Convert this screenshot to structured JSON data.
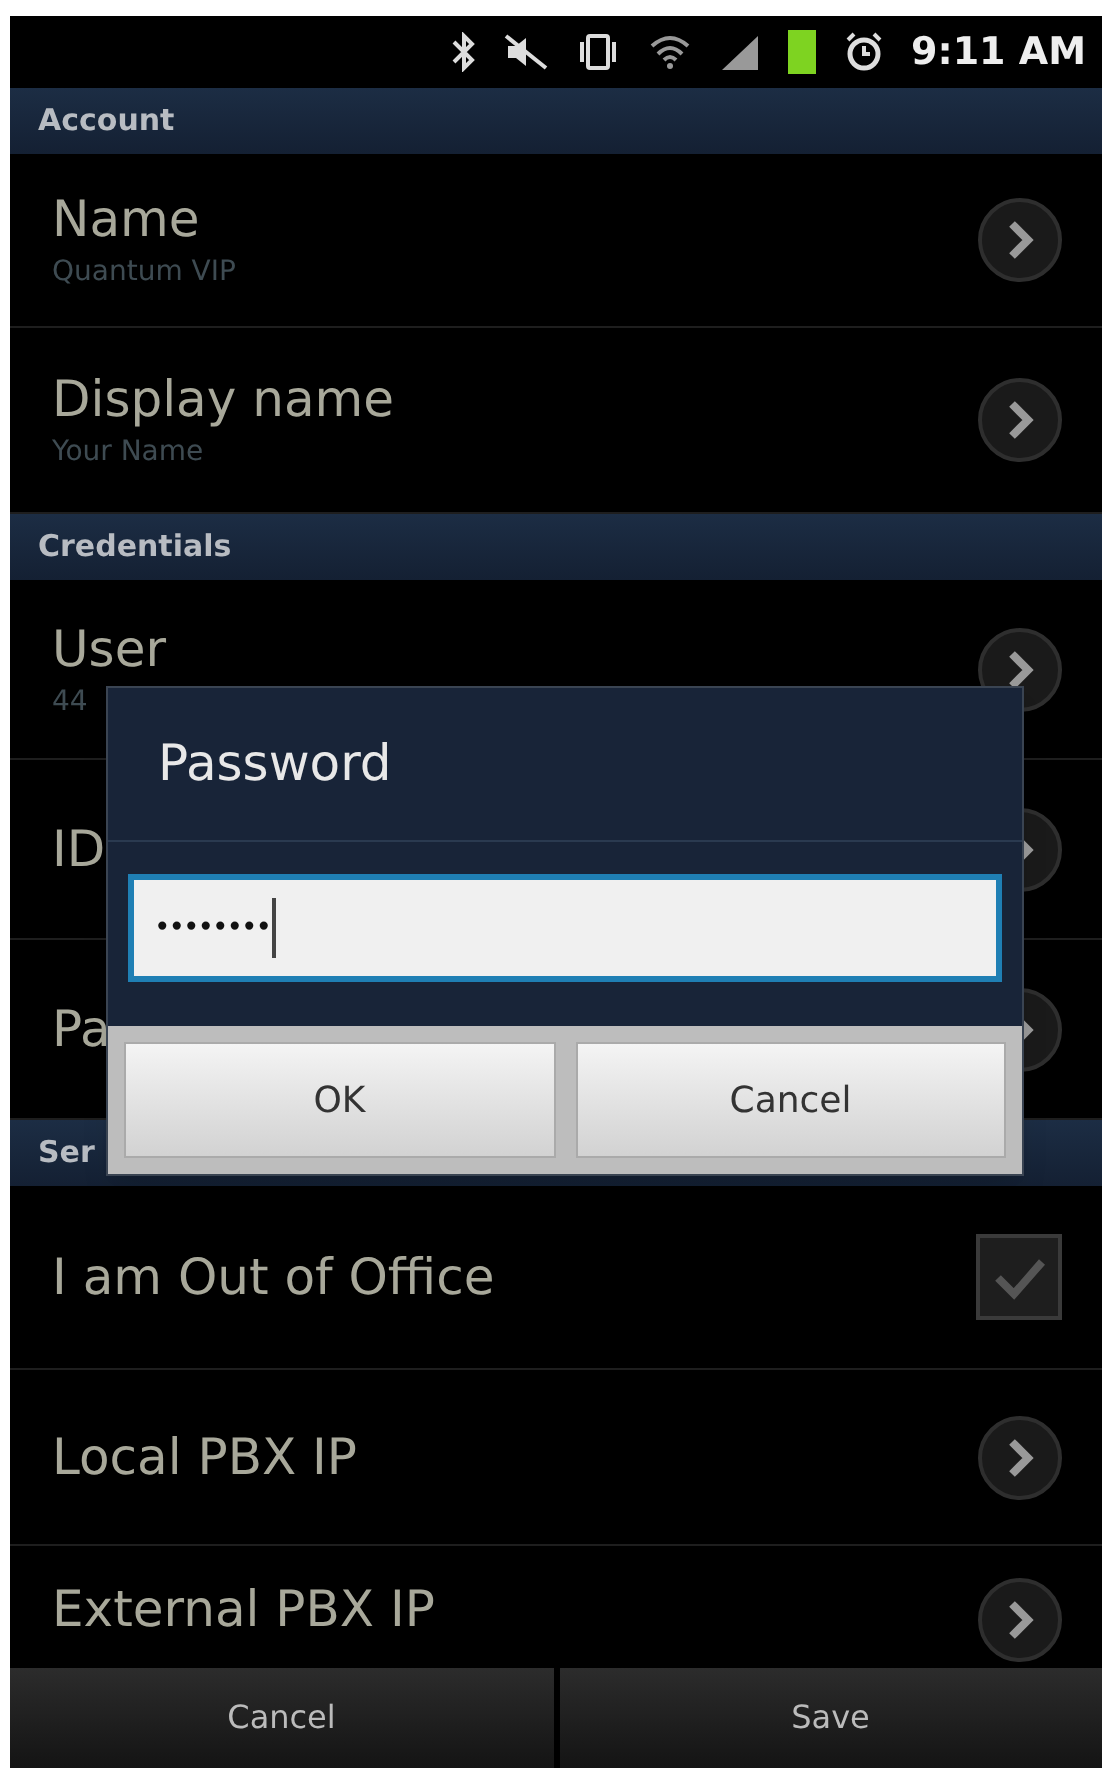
{
  "status_bar": {
    "time": "9:11 AM"
  },
  "sections": [
    {
      "title": "Account",
      "items": [
        {
          "kind": "chevron",
          "title": "Name",
          "summary": "Quantum VIP"
        },
        {
          "kind": "chevron",
          "title": "Display name",
          "summary": "Your Name"
        }
      ]
    },
    {
      "title": "Credentials",
      "items": [
        {
          "kind": "chevron",
          "title": "User",
          "summary": "44"
        },
        {
          "kind": "chevron",
          "title": "ID"
        },
        {
          "kind": "chevron",
          "title": "Pa"
        }
      ]
    },
    {
      "title": "Ser",
      "items": [
        {
          "kind": "checkbox",
          "title": "I am Out of Office",
          "checked": true
        },
        {
          "kind": "chevron",
          "title": "Local PBX IP"
        },
        {
          "kind": "chevron",
          "title": "External PBX IP"
        }
      ]
    }
  ],
  "dialog": {
    "title": "Password",
    "value": "••••••••",
    "buttons": [
      "OK",
      "Cancel"
    ]
  },
  "bottom_bar": {
    "buttons": [
      "Cancel",
      "Save"
    ]
  }
}
